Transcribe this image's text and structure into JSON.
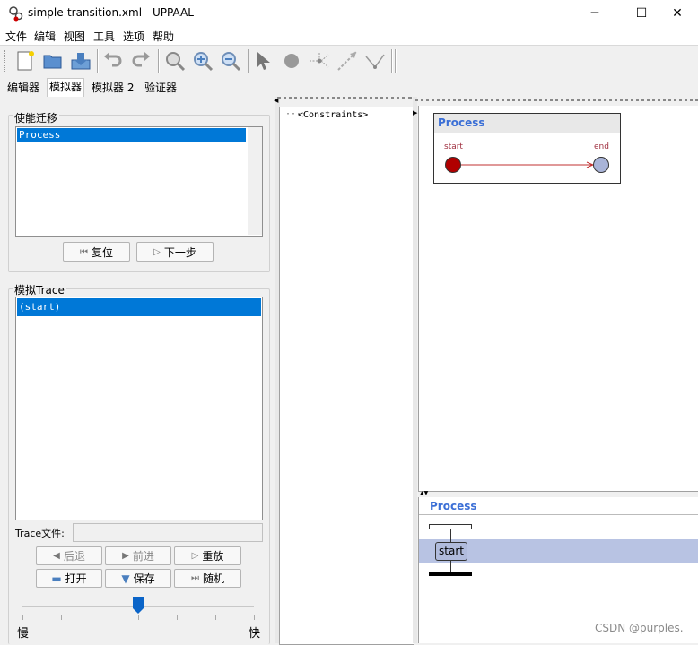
{
  "window": {
    "title": "simple-transition.xml - UPPAAL",
    "minimize": "─",
    "maximize": "☐",
    "close": "✕"
  },
  "menu": [
    "文件",
    "编辑",
    "视图",
    "工具",
    "选项",
    "帮助"
  ],
  "toolbar_icons": [
    "new-icon",
    "open-icon",
    "save-icon",
    "undo-icon",
    "redo-icon",
    "zoom-fit-icon",
    "zoom-in-icon",
    "zoom-out-icon",
    "select-icon",
    "location-icon",
    "branch-icon",
    "edge-icon",
    "nail-icon"
  ],
  "tabs": [
    "编辑器",
    "模拟器",
    "模拟器 2",
    "验证器"
  ],
  "active_tab": "模拟器",
  "enabled_transitions": {
    "title": "使能迁移",
    "items": [
      "Process"
    ],
    "reset_label": "复位",
    "next_label": "下一步"
  },
  "trace": {
    "title": "模拟Trace",
    "items": [
      "(start)"
    ],
    "file_label": "Trace文件:",
    "file_value": "",
    "back_label": "后退",
    "forward_label": "前进",
    "replay_label": "重放",
    "open_label": "打开",
    "save_label": "保存",
    "random_label": "随机",
    "speed_slow": "慢",
    "speed_fast": "快",
    "speed_level": 0.5
  },
  "variables": {
    "root_label": "<Constraints>"
  },
  "process_view": {
    "name": "Process",
    "start_label": "start",
    "end_label": "end"
  },
  "sequence_chart": {
    "process_name": "Process",
    "state_label": "start"
  },
  "watermark": "CSDN @purples.",
  "colors": {
    "selection": "#0078d7",
    "process_title": "#3b6fd6",
    "start_state": "#b00000",
    "end_state": "#a9b4d8",
    "msc_row": "#b8c3e3"
  }
}
